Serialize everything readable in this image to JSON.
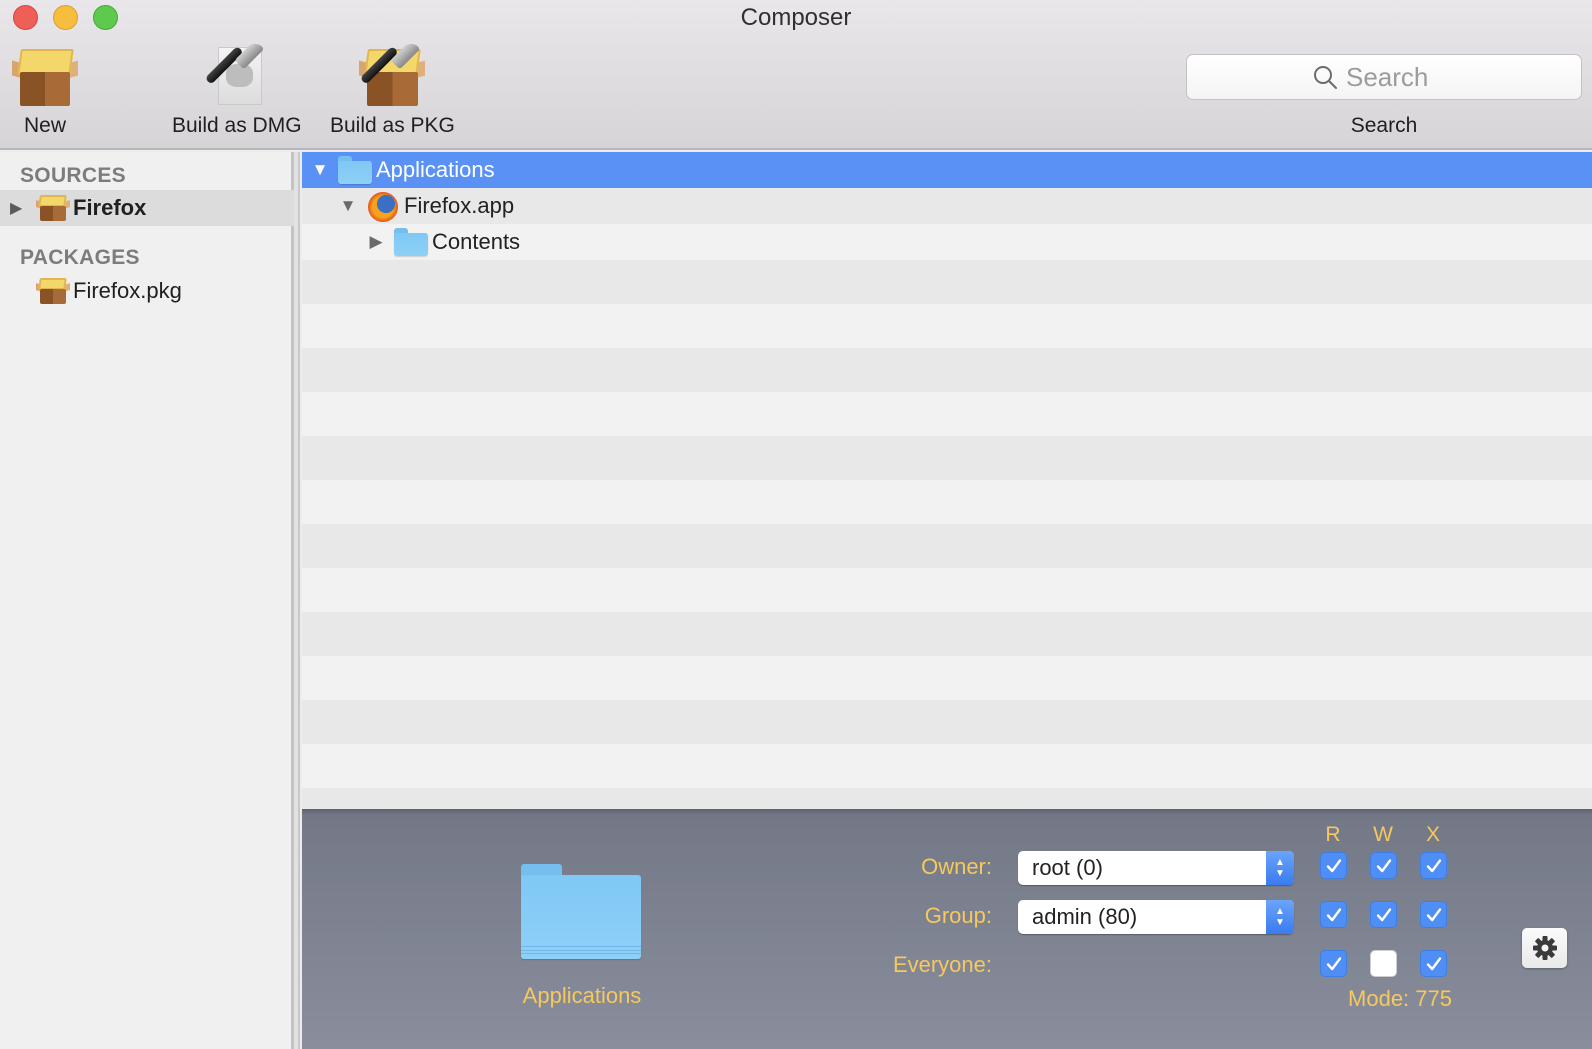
{
  "window": {
    "title": "Composer",
    "controls": [
      "close",
      "minimize",
      "zoom"
    ]
  },
  "toolbar": {
    "items": [
      {
        "label": "New",
        "icon": "package-box-icon"
      },
      {
        "label": "Build as DMG",
        "icon": "hammer-disk-icon"
      },
      {
        "label": "Build as PKG",
        "icon": "hammer-package-icon"
      }
    ],
    "search": {
      "placeholder": "Search",
      "value": "",
      "label": "Search"
    }
  },
  "sidebar": {
    "sections": [
      {
        "header": "SOURCES",
        "items": [
          {
            "label": "Firefox",
            "icon": "package-box-icon",
            "selected": true,
            "expandable": true,
            "expanded": false
          }
        ]
      },
      {
        "header": "PACKAGES",
        "items": [
          {
            "label": "Firefox.pkg",
            "icon": "package-box-icon",
            "selected": false,
            "expandable": false
          }
        ]
      }
    ]
  },
  "outline": {
    "rows": [
      {
        "label": "Applications",
        "icon": "folder-icon",
        "depth": 0,
        "expanded": true,
        "selected": true
      },
      {
        "label": "Firefox.app",
        "icon": "firefox-icon",
        "depth": 1,
        "expanded": true,
        "selected": false
      },
      {
        "label": "Contents",
        "icon": "folder-icon",
        "depth": 2,
        "expanded": false,
        "selected": false
      }
    ]
  },
  "info_panel": {
    "item_name": "Applications",
    "item_icon": "folder-icon",
    "owner_label": "Owner:",
    "owner_value": "root (0)",
    "group_label": "Group:",
    "group_value": "admin (80)",
    "everyone_label": "Everyone:",
    "columns": [
      "R",
      "W",
      "X"
    ],
    "permissions": {
      "owner": {
        "r": true,
        "w": true,
        "x": true
      },
      "group": {
        "r": true,
        "w": true,
        "x": true
      },
      "everyone": {
        "r": true,
        "w": false,
        "x": true
      }
    },
    "mode_text": "Mode: 775",
    "colors": {
      "label": "#f6c85e",
      "checkbox_on": "#4f8ef5",
      "selection": "#5a91f5"
    }
  }
}
